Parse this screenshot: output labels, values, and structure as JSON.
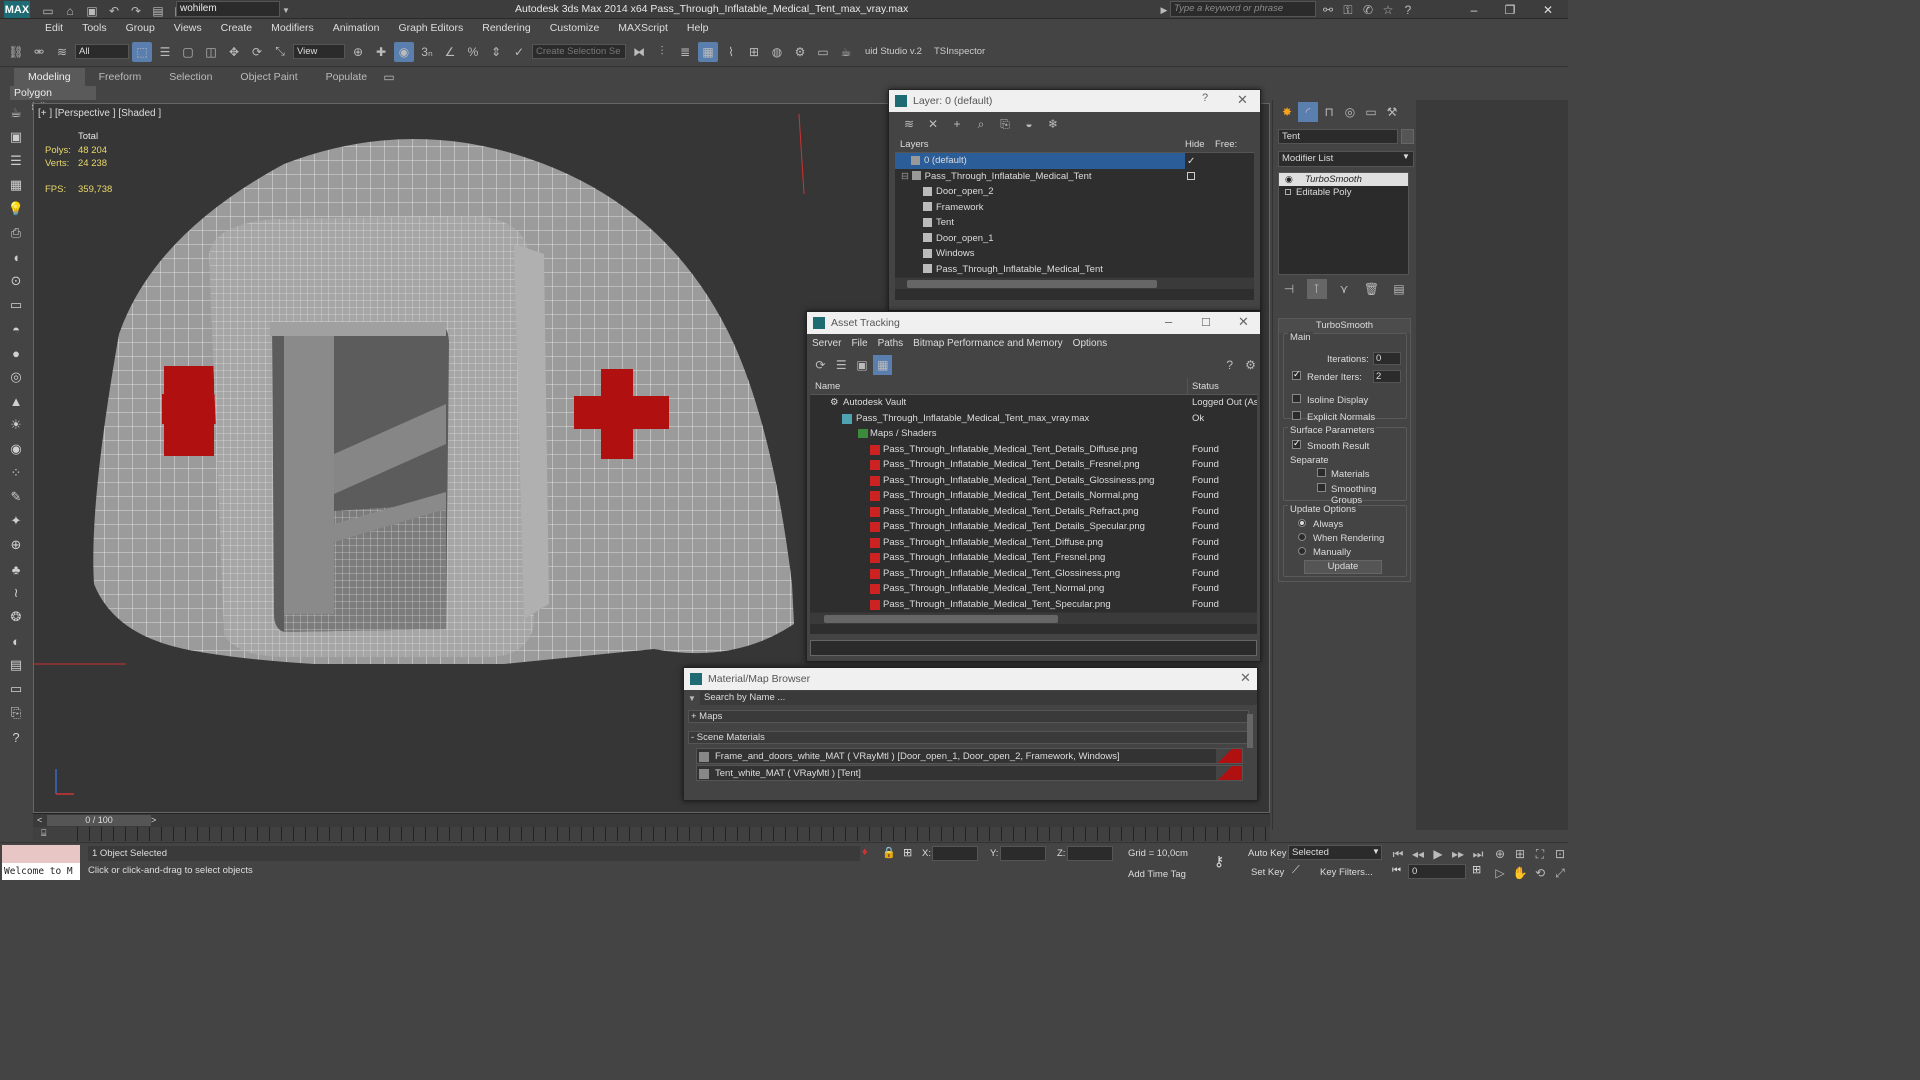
{
  "titlebar": {
    "app_logo": "MAX",
    "workspace": "wohilem",
    "title": "Autodesk 3ds Max  2014 x64     Pass_Through_Inflatable_Medical_Tent_max_vray.max",
    "search_placeholder": "Type a keyword or phrase"
  },
  "menu": [
    "Edit",
    "Tools",
    "Group",
    "Views",
    "Create",
    "Modifiers",
    "Animation",
    "Graph Editors",
    "Rendering",
    "Customize",
    "MAXScript",
    "Help"
  ],
  "toolbar": {
    "filter": "All",
    "ref_coord": "View",
    "selection_set_placeholder": "Create Selection Se",
    "studio_label": "uid Studio v.2",
    "inspector_label": "TSInspector"
  },
  "ribbon": {
    "tabs": [
      "Modeling",
      "Freeform",
      "Selection",
      "Object Paint",
      "Populate"
    ],
    "active": "Modeling",
    "subtab": "Polygon Modeling"
  },
  "viewport": {
    "label": "[+ ] [Perspective ] [Shaded ]",
    "stats": {
      "total_label": "Total",
      "polys_label": "Polys:",
      "polys": "48 204",
      "verts_label": "Verts:",
      "verts": "24 238",
      "fps_label": "FPS:",
      "fps": "359,738"
    }
  },
  "layer_dialog": {
    "title": "Layer: 0 (default)",
    "help": "?",
    "col_layers": "Layers",
    "col_hide": "Hide",
    "col_freeze": "Free:",
    "rows": [
      "0 (default)",
      "Pass_Through_Inflatable_Medical_Tent",
      "Door_open_2",
      "Framework",
      "Tent",
      "Door_open_1",
      "Windows",
      "Pass_Through_Inflatable_Medical_Tent"
    ]
  },
  "asset_dialog": {
    "title": "Asset Tracking",
    "menu": [
      "Server",
      "File",
      "Paths",
      "Bitmap Performance and Memory",
      "Options"
    ],
    "col_name": "Name",
    "col_status": "Status",
    "vault": {
      "name": "Autodesk Vault",
      "status": "Logged Out (As"
    },
    "scene": {
      "name": "Pass_Through_Inflatable_Medical_Tent_max_vray.max",
      "status": "Ok"
    },
    "folder": "Maps / Shaders",
    "files": [
      {
        "name": "Pass_Through_Inflatable_Medical_Tent_Details_Diffuse.png",
        "status": "Found"
      },
      {
        "name": "Pass_Through_Inflatable_Medical_Tent_Details_Fresnel.png",
        "status": "Found"
      },
      {
        "name": "Pass_Through_Inflatable_Medical_Tent_Details_Glossiness.png",
        "status": "Found"
      },
      {
        "name": "Pass_Through_Inflatable_Medical_Tent_Details_Normal.png",
        "status": "Found"
      },
      {
        "name": "Pass_Through_Inflatable_Medical_Tent_Details_Refract.png",
        "status": "Found"
      },
      {
        "name": "Pass_Through_Inflatable_Medical_Tent_Details_Specular.png",
        "status": "Found"
      },
      {
        "name": "Pass_Through_Inflatable_Medical_Tent_Diffuse.png",
        "status": "Found"
      },
      {
        "name": "Pass_Through_Inflatable_Medical_Tent_Fresnel.png",
        "status": "Found"
      },
      {
        "name": "Pass_Through_Inflatable_Medical_Tent_Glossiness.png",
        "status": "Found"
      },
      {
        "name": "Pass_Through_Inflatable_Medical_Tent_Normal.png",
        "status": "Found"
      },
      {
        "name": "Pass_Through_Inflatable_Medical_Tent_Specular.png",
        "status": "Found"
      }
    ]
  },
  "material_browser": {
    "title": "Material/Map Browser",
    "search_placeholder": "Search by Name ...",
    "maps_section": "+ Maps",
    "scene_section": "- Scene Materials",
    "materials": [
      "Frame_and_doors_white_MAT  ( VRayMtl )  [Door_open_1, Door_open_2, Framework, Windows]",
      "Tent_white_MAT  ( VRayMtl )  [Tent]"
    ]
  },
  "command_panel": {
    "object_name": "Tent",
    "modifier_list": "Modifier List",
    "stack": [
      "TurboSmooth",
      "Editable Poly"
    ],
    "rollout_title": "TurboSmooth",
    "main_group": "Main",
    "iterations_label": "Iterations:",
    "iterations": "0",
    "render_iters_label": "Render Iters:",
    "render_iters": "2",
    "isoline": "Isoline Display",
    "explicit_normals": "Explicit Normals",
    "surface_group": "Surface Parameters",
    "smooth_result": "Smooth Result",
    "separate_label": "Separate",
    "materials": "Materials",
    "smoothing_groups": "Smoothing Groups",
    "update_group": "Update Options",
    "always": "Always",
    "when_rendering": "When Rendering",
    "manually": "Manually",
    "update_button": "Update"
  },
  "timeline": {
    "frame": "0 / 100"
  },
  "status": {
    "maxscript": "Welcome to M",
    "selected": "1 Object Selected",
    "prompt": "Click or click-and-drag to select objects",
    "x_label": "X:",
    "y_label": "Y:",
    "z_label": "Z:",
    "grid": "Grid = 10,0cm",
    "add_time_tag": "Add Time Tag",
    "auto_key": "Auto Key",
    "set_key": "Set Key",
    "key_mode": "Selected",
    "key_filters": "Key Filters...",
    "frame_field": "0"
  }
}
